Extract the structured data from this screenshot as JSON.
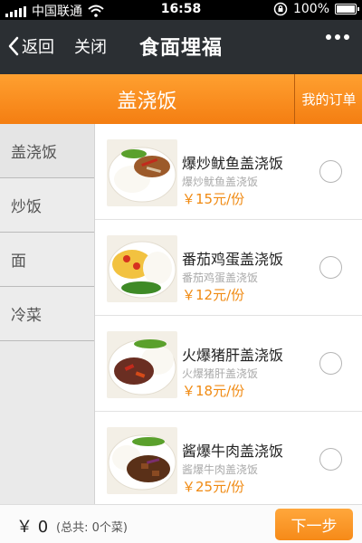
{
  "status_bar": {
    "carrier": "中国联通",
    "time": "16:58",
    "battery": "100%",
    "icons": [
      "signal-icon",
      "wifi-icon",
      "rotation-lock-icon",
      "battery-icon"
    ]
  },
  "nav": {
    "back_label": "返回",
    "close_label": "关闭",
    "title": "食面埋福",
    "icons": [
      "chevron-left-icon",
      "more-dots-icon"
    ]
  },
  "tabs": {
    "current": "盖浇饭",
    "orders": "我的订单"
  },
  "categories": [
    {
      "label": "盖浇饭"
    },
    {
      "label": "炒饭"
    },
    {
      "label": "面"
    },
    {
      "label": "冷菜"
    }
  ],
  "items": [
    {
      "name": "爆炒鱿鱼盖浇饭",
      "subtitle": "爆炒鱿鱼盖浇饭",
      "price": "￥15元/份",
      "selected": false
    },
    {
      "name": "番茄鸡蛋盖浇饭",
      "subtitle": "番茄鸡蛋盖浇饭",
      "price": "￥12元/份",
      "selected": false
    },
    {
      "name": "火爆猪肝盖浇饭",
      "subtitle": "火爆猪肝盖浇饭",
      "price": "￥18元/份",
      "selected": false
    },
    {
      "name": "酱爆牛肉盖浇饭",
      "subtitle": "酱爆牛肉盖浇饭",
      "price": "￥25元/份",
      "selected": false
    }
  ],
  "footer": {
    "total": "￥ 0",
    "summary": "(总共: 0个菜)",
    "next_label": "下一步"
  },
  "colors": {
    "accent": "#f68a18",
    "nav_bg": "#2b2f33",
    "price": "#f08a12"
  }
}
